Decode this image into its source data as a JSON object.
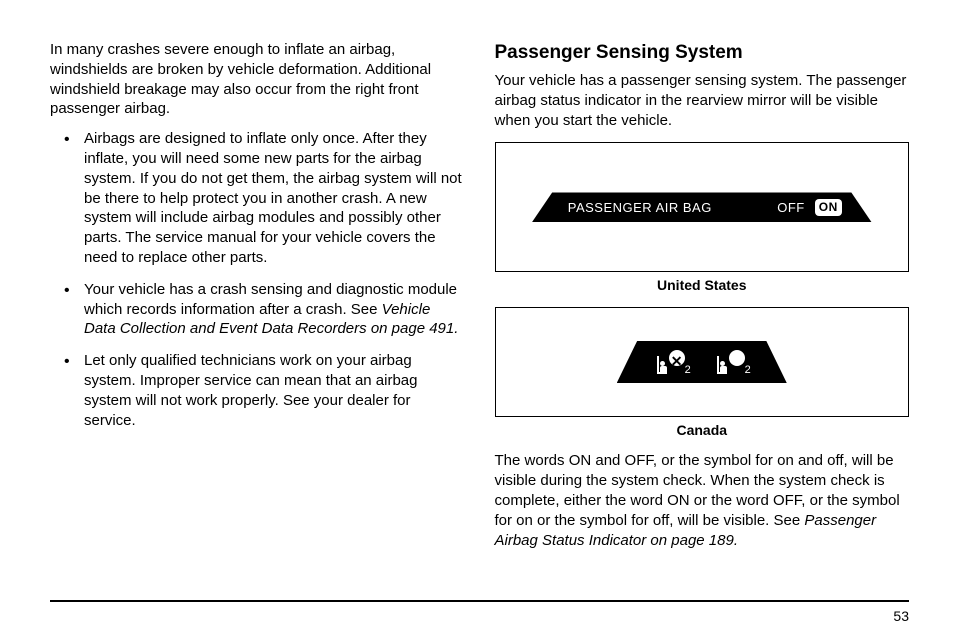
{
  "left": {
    "intro": "In many crashes severe enough to inflate an airbag, windshields are broken by vehicle deformation. Additional windshield breakage may also occur from the right front passenger airbag.",
    "bullets": [
      {
        "text": "Airbags are designed to inflate only once. After they inflate, you will need some new parts for the airbag system. If you do not get them, the airbag system will not be there to help protect you in another crash. A new system will include airbag modules and possibly other parts. The service manual for your vehicle covers the need to replace other parts."
      },
      {
        "text_a": "Your vehicle has a crash sensing and diagnostic module which records information after a crash. See ",
        "italic": "Vehicle Data Collection and Event Data Recorders on page 491.",
        "text_b": ""
      },
      {
        "text": "Let only qualified technicians work on your airbag system. Improper service can mean that an airbag system will not work properly. See your dealer for service."
      }
    ]
  },
  "right": {
    "heading": "Passenger Sensing System",
    "para1": "Your vehicle has a passenger sensing system. The passenger airbag status indicator in the rearview mirror will be visible when you start the vehicle.",
    "us_label": "PASSENGER AIR BAG",
    "us_off": "OFF",
    "us_on": "ON",
    "caption_us": "United States",
    "caption_ca": "Canada",
    "para2_a": "The words ON and OFF, or the symbol for on and off, will be visible during the system check. When the system check is complete, either the word ON or the word OFF, or the symbol for on or the symbol for off, will be visible. See ",
    "para2_italic": "Passenger Airbag Status Indicator on page 189.",
    "sub": "2"
  },
  "page": "53"
}
